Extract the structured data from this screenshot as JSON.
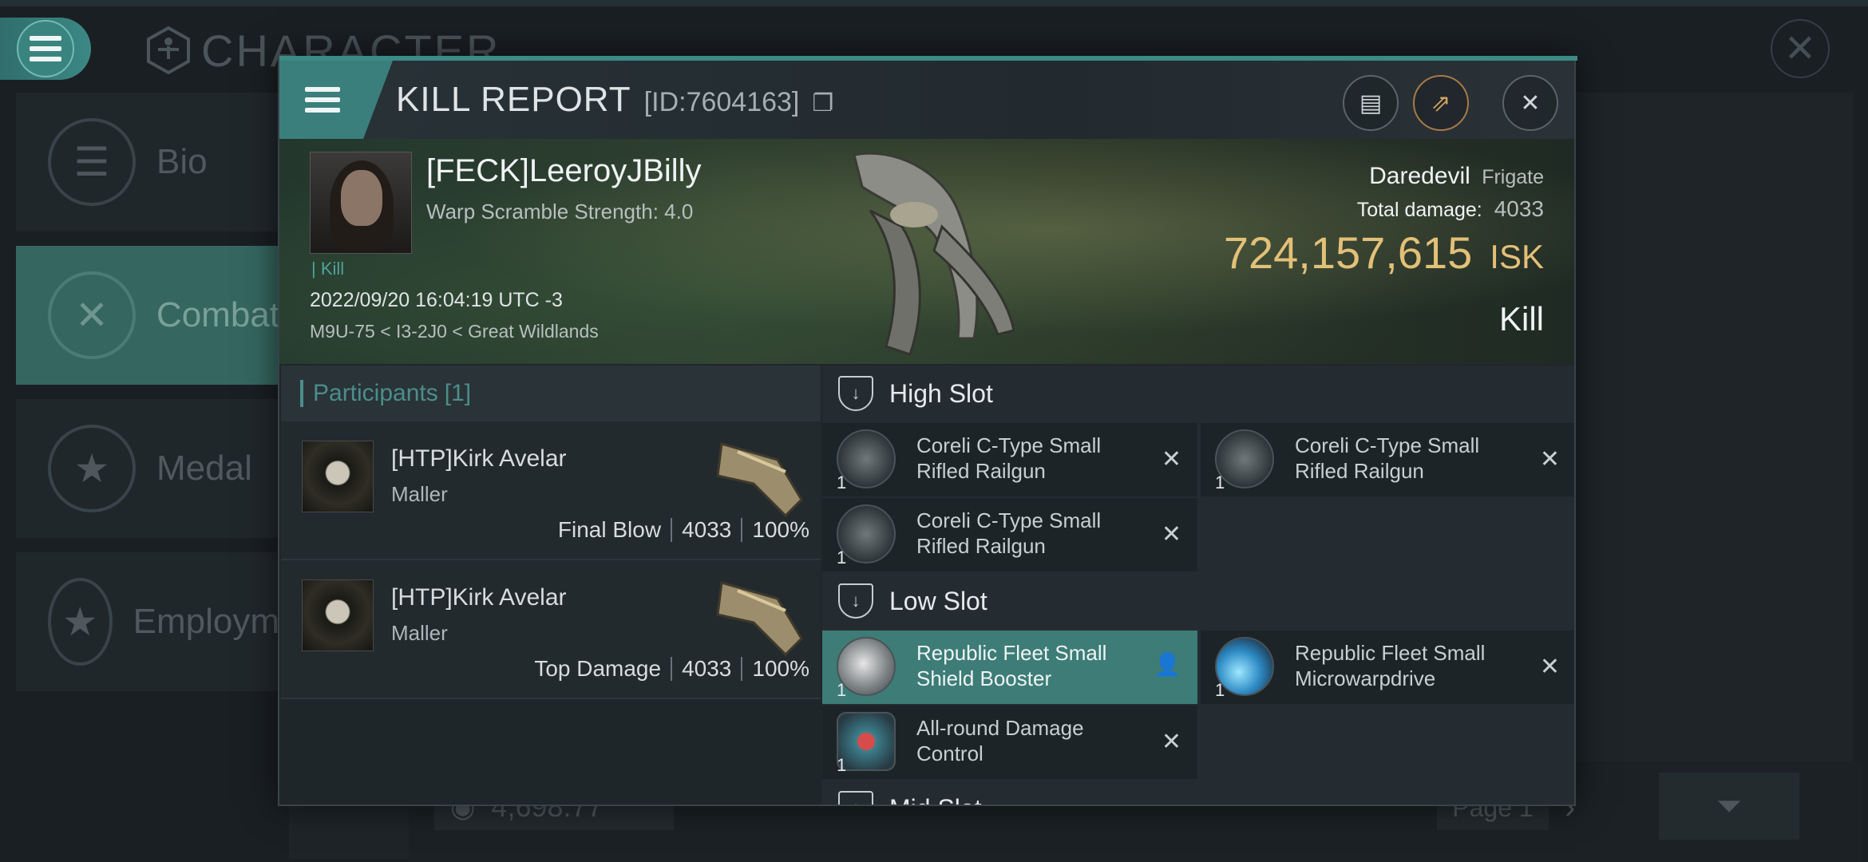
{
  "background": {
    "title": "CHARACTER",
    "sidebar": [
      {
        "label": "Bio",
        "icon": "list-icon"
      },
      {
        "label": "Combat",
        "icon": "crossed-swords-icon"
      },
      {
        "label": "Medal",
        "icon": "star-badge-icon"
      },
      {
        "label": "Employm",
        "icon": "star-icon"
      }
    ],
    "isk_value": "4,698.77",
    "page_label": "Page 1"
  },
  "modal": {
    "title": "KILL REPORT",
    "report_id": "[ID:7604163]",
    "victim": {
      "pilot": "[FECK]LeeroyJBilly",
      "scramble": "Warp Scramble Strength: 4.0",
      "kill_tag": "| Kill",
      "datetime": "2022/09/20 16:04:19 UTC -3",
      "location": "M9U-75 < I3-2J0 < Great Wildlands",
      "ship_name": "Daredevil",
      "ship_class": "Frigate",
      "total_damage_label": "Total damage:",
      "total_damage": "4033",
      "isk_value": "724,157,615",
      "isk_unit": "ISK",
      "result": "Kill"
    },
    "participants": {
      "header": "Participants",
      "count": "[1]",
      "rows": [
        {
          "name": "[HTP]Kirk Avelar",
          "ship": "Maller",
          "role": "Final Blow",
          "damage": "4033",
          "percent": "100%"
        },
        {
          "name": "[HTP]Kirk Avelar",
          "ship": "Maller",
          "role": "Top Damage",
          "damage": "4033",
          "percent": "100%"
        }
      ]
    },
    "fitting": {
      "high_slot_label": "High Slot",
      "low_slot_label": "Low Slot",
      "mid_slot_label": "Mid Slot",
      "high": [
        {
          "line1": "Coreli C-Type Small",
          "line2": "Rifled Railgun",
          "qty": "1"
        },
        {
          "line1": "Coreli C-Type Small",
          "line2": "Rifled Railgun",
          "qty": "1"
        },
        {
          "line1": "Coreli C-Type Small",
          "line2": "Rifled Railgun",
          "qty": "1"
        }
      ],
      "low": [
        {
          "line1": "Republic Fleet Small",
          "line2": "Shield Booster",
          "qty": "1"
        },
        {
          "line1": "Republic Fleet Small",
          "line2": "Microwarpdrive",
          "qty": "1"
        },
        {
          "line1": "All-round Damage",
          "line2": "Control",
          "qty": "1"
        }
      ]
    }
  },
  "colors": {
    "accent": "#3b8a86",
    "isk_gold": "#e3c078",
    "active_module": "#3d7c77"
  }
}
